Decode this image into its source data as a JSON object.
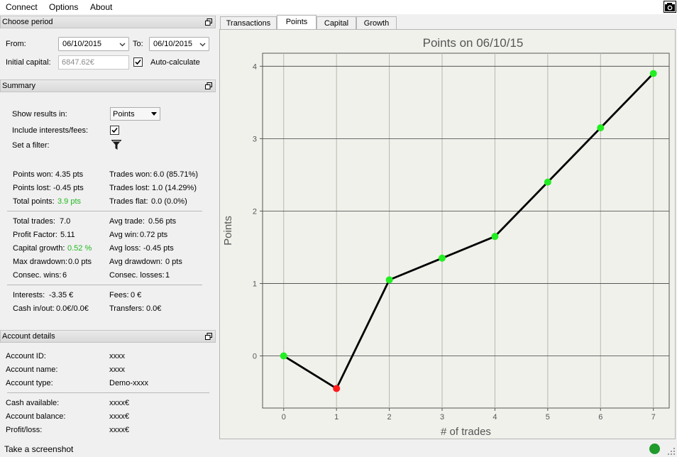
{
  "menu": {
    "items": [
      "Connect",
      "Options",
      "About"
    ]
  },
  "choose_period": {
    "title": "Choose period",
    "from_label": "From:",
    "from_value": "06/10/2015",
    "to_label": "To:",
    "to_value": "06/10/2015",
    "initial_capital_label": "Initial capital:",
    "initial_capital_value": "6847.62€",
    "auto_calc_label": "Auto-calculate",
    "auto_calc_checked": true
  },
  "summary": {
    "title": "Summary",
    "show_results_label": "Show results in:",
    "show_results_value": "Points",
    "include_label": "Include interests/fees:",
    "include_checked": true,
    "filter_label": "Set a filter:",
    "points_won_label": "Points won:",
    "points_won": "4.35 pts",
    "trades_won_label": "Trades won:",
    "trades_won": "6.0 (85.71%)",
    "points_lost_label": "Points lost:",
    "points_lost": "-0.45 pts",
    "trades_lost_label": "Trades lost:",
    "trades_lost": "1.0 (14.29%)",
    "total_points_label": "Total points:",
    "total_points": "3.9 pts",
    "trades_flat_label": "Trades flat:",
    "trades_flat": "0.0 (0.0%)",
    "total_trades_label": "Total trades:",
    "total_trades": "7.0",
    "avg_trade_label": "Avg trade:",
    "avg_trade": "0.56 pts",
    "profit_factor_label": "Profit Factor:",
    "profit_factor": "5.11",
    "avg_win_label": "Avg win:",
    "avg_win": "0.72 pts",
    "capital_growth_label": "Capital growth:",
    "capital_growth": "0.52 %",
    "avg_loss_label": "Avg loss:",
    "avg_loss": "-0.45 pts",
    "max_drawdown_label": "Max drawdown:",
    "max_drawdown": "0.0 pts",
    "avg_drawdown_label": "Avg drawdown:",
    "avg_drawdown": "0 pts",
    "consec_wins_label": "Consec. wins:",
    "consec_wins": "6",
    "consec_losses_label": "Consec. losses:",
    "consec_losses": "1",
    "interests_label": "Interests:",
    "interests": "-3.35 €",
    "fees_label": "Fees:",
    "fees": "0 €",
    "cash_io_label": "Cash in/out:",
    "cash_io": "0.0€/0.0€",
    "transfers_label": "Transfers:",
    "transfers": "0.0€"
  },
  "account": {
    "title": "Account details",
    "id_label": "Account ID:",
    "id": "xxxx",
    "name_label": "Account name:",
    "name": "xxxx",
    "type_label": "Account type:",
    "type": "Demo-xxxx",
    "cash_label": "Cash available:",
    "cash": "xxxx€",
    "balance_label": "Account balance:",
    "balance": "xxxx€",
    "pl_label": "Profit/loss:",
    "pl": "xxxx€"
  },
  "tabs": [
    "Transactions",
    "Points",
    "Capital",
    "Growth"
  ],
  "active_tab": "Points",
  "status": {
    "text": "Take a screenshot"
  },
  "colors": {
    "win": "#22ee22",
    "loss": "#ff1a1a",
    "status_ok": "#1f9a2b",
    "highlight": "#22b822"
  },
  "chart_data": {
    "type": "line",
    "title": "Points on 06/10/15",
    "xlabel": "# of trades",
    "ylabel": "Points",
    "x": [
      0,
      1,
      2,
      3,
      4,
      5,
      6,
      7
    ],
    "y": [
      0.0,
      -0.45,
      1.05,
      1.35,
      1.65,
      2.4,
      3.15,
      3.9
    ],
    "point_status": [
      "win",
      "loss",
      "win",
      "win",
      "win",
      "win",
      "win",
      "win"
    ],
    "xlim": [
      -0.4,
      7.3
    ],
    "ylim": [
      -0.72,
      4.18
    ],
    "xticks": [
      0,
      1,
      2,
      3,
      4,
      5,
      6,
      7
    ],
    "yticks": [
      0,
      1,
      2,
      3,
      4
    ],
    "grid": true
  }
}
